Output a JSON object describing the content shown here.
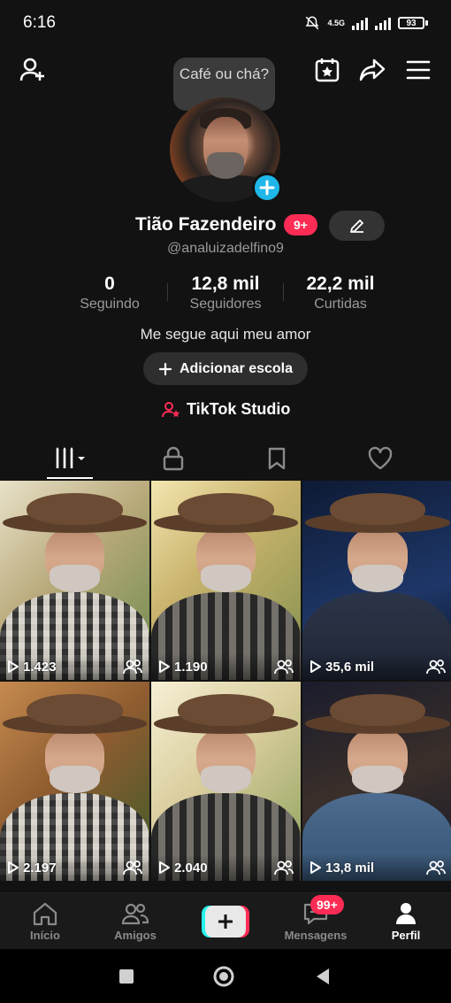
{
  "status_bar": {
    "time": "6:16",
    "network": "4.5G",
    "battery": "93"
  },
  "header": {
    "tooltip": "Café ou chá?"
  },
  "profile": {
    "name": "Tião Fazendeiro",
    "name_badge": "9+",
    "handle": "@analuizadelfino9",
    "bio": "Me segue aqui meu amor",
    "add_school_label": "Adicionar escola",
    "studio_label": "TikTok Studio"
  },
  "stats": [
    {
      "value": "0",
      "label": "Seguindo"
    },
    {
      "value": "12,8 mil",
      "label": "Seguidores"
    },
    {
      "value": "22,2 mil",
      "label": "Curtidas"
    }
  ],
  "tabs": [
    "videos-grid-icon",
    "lock-icon",
    "bookmark-icon",
    "heart-icon"
  ],
  "videos": [
    {
      "views": "1.423",
      "bg": "linear-gradient(135deg,#e9e2c9,#b8a97a 45%,#6b8a4a)",
      "shirt": "plaid2"
    },
    {
      "views": "1.190",
      "bg": "linear-gradient(135deg,#f3e6b0,#c9b36d 40%,#7f8f4c)",
      "shirt": "plaid"
    },
    {
      "views": "35,6 mil",
      "bg": "linear-gradient(160deg,#0e1a34,#1e3768 60%,#0c1428)",
      "shirt": "darkshirt"
    },
    {
      "views": "2.197",
      "bg": "linear-gradient(135deg,#c58a4e,#8f5c30 45%,#3d5a2a)",
      "shirt": "plaid2"
    },
    {
      "views": "2.040",
      "bg": "linear-gradient(135deg,#f6efd4,#d8cc9b 45%,#8aa05b)",
      "shirt": "plaid"
    },
    {
      "views": "13,8 mil",
      "bg": "linear-gradient(160deg,#1a1c2c,#3a2f2a 50%,#15182a)",
      "shirt": "denim"
    }
  ],
  "bottom_nav": {
    "home": "Início",
    "friends": "Amigos",
    "messages": "Mensagens",
    "messages_badge": "99+",
    "profile": "Perfil"
  },
  "colors": {
    "accent_red": "#fe2c55",
    "accent_cyan": "#25f4ee",
    "add_blue": "#1fb6e8"
  }
}
